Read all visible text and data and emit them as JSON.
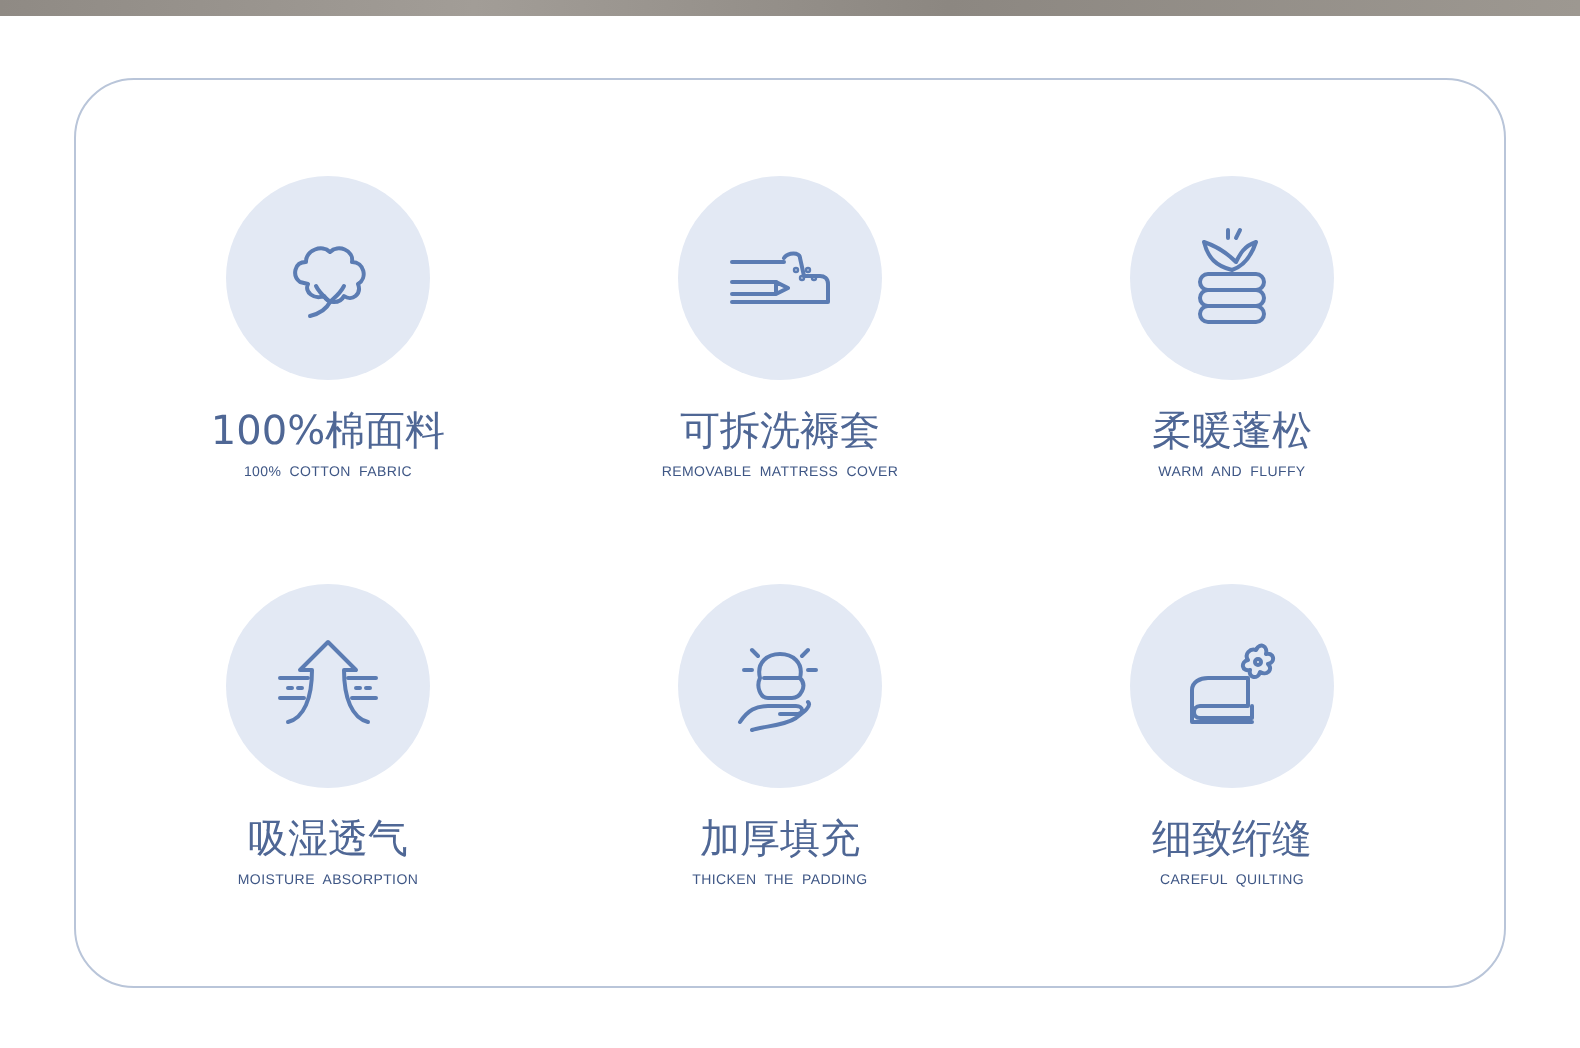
{
  "features": [
    {
      "kind": "cotton",
      "title": "100%棉面料",
      "subtitle": "100% COTTON FABRIC"
    },
    {
      "kind": "mattress",
      "title": "可拆洗褥套",
      "subtitle": "REMOVABLE MATTRESS COVER"
    },
    {
      "kind": "feather",
      "title": "柔暖蓬松",
      "subtitle": "WARM AND FLUFFY"
    },
    {
      "kind": "breathable",
      "title": "吸湿透气",
      "subtitle": "MOISTURE ABSORPTION"
    },
    {
      "kind": "padding",
      "title": "加厚填充",
      "subtitle": "THICKEN THE PADDING"
    },
    {
      "kind": "quilting",
      "title": "细致绗缝",
      "subtitle": "CAREFUL QUILTING"
    }
  ]
}
